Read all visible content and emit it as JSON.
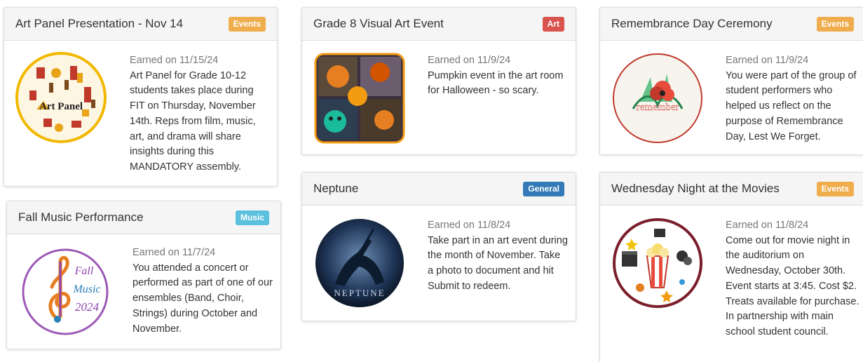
{
  "colors": {
    "events": "#f0ad4e",
    "art": "#d9534f",
    "general": "#337ab7",
    "music": "#5bc0de"
  },
  "cards": [
    {
      "title": "Art Panel Presentation - Nov 14",
      "badge": "Events",
      "earned": "Earned on 11/15/24",
      "description": "Art Panel for Grade 10-12 students takes place during FIT on Thursday, November 14th. Reps from film, music, art, and drama will share insights during this MANDATORY assembly.",
      "image_text": "Art Panel",
      "icon": "art-panel-image"
    },
    {
      "title": "Fall Music Performance",
      "badge": "Music",
      "earned": "Earned on 11/7/24",
      "description": "You attended a concert or performed as part of one of our ensembles (Band, Choir, Strings) during October and November.",
      "image_text": [
        "Fall",
        "Music",
        "2024"
      ],
      "icon": "treble-clef-image"
    },
    {
      "title": "Grade 8 Visual Art Event",
      "badge": "Art",
      "earned": "Earned on 11/9/24",
      "description": "Pumpkin event in the art room for Halloween - so scary.",
      "icon": "pumpkin-photo-image"
    },
    {
      "title": "Neptune",
      "badge": "General",
      "earned": "Earned on 11/8/24",
      "description": "Take part in an art event during the month of November. Take a photo to document and hit Submit to redeem.",
      "image_text": "NEPTUNE",
      "icon": "neptune-statue-image"
    },
    {
      "title": "Remembrance Day Ceremony",
      "badge": "Events",
      "earned": "Earned on 11/9/24",
      "description": "You were part of the group of student performers who helped us reflect on the purpose of Remembrance Day, Lest We Forget.",
      "image_text": "remember",
      "icon": "poppy-image"
    },
    {
      "title": "Wednesday Night at the Movies",
      "badge": "Events",
      "earned": "Earned on 11/8/24",
      "description": "Come out for movie night in the auditorium on Wednesday, October 30th. Event starts at 3:45. Cost $2. Treats available for purchase. In partnership with main school student council.",
      "icon": "popcorn-movie-image"
    }
  ]
}
